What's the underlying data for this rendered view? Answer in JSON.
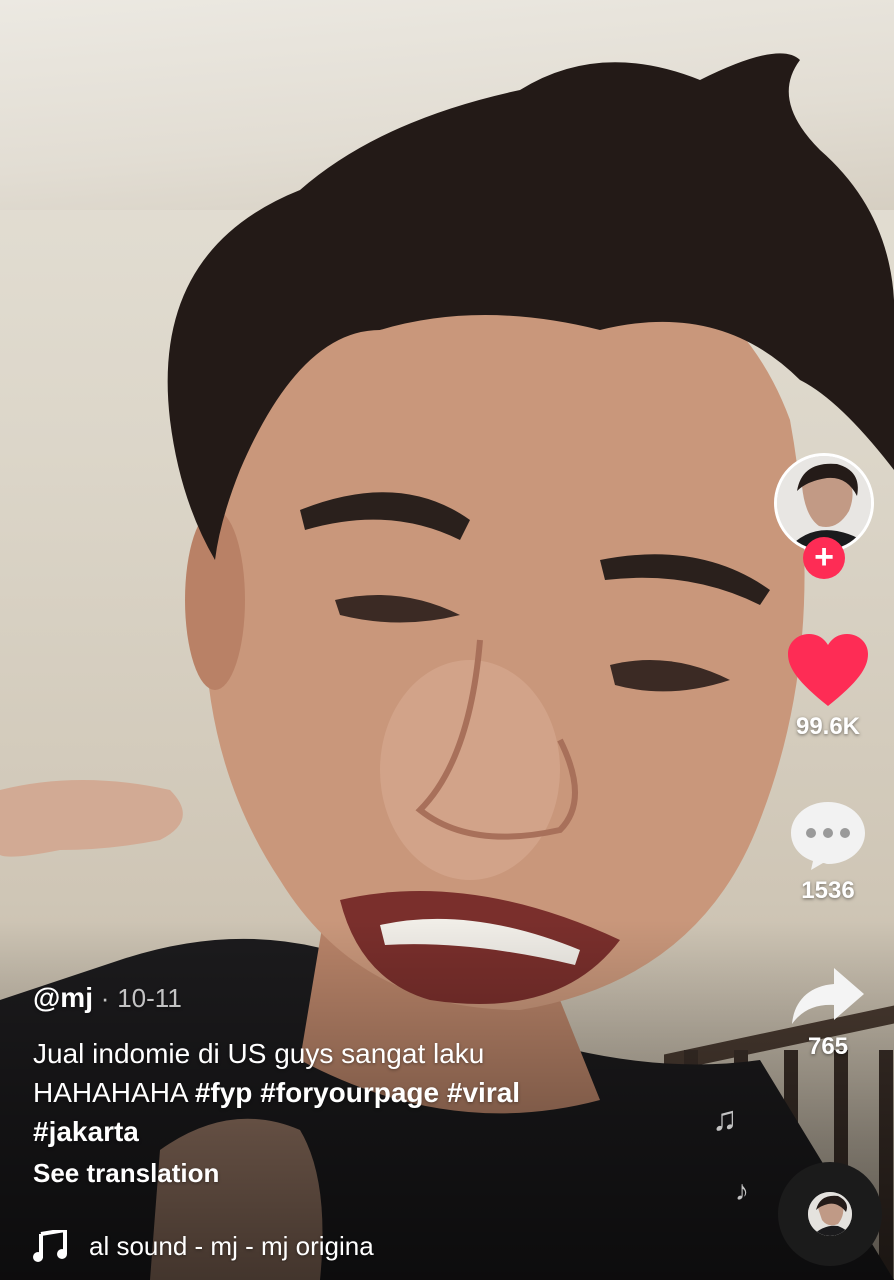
{
  "sidebar": {
    "likes": "99.6K",
    "comments": "1536",
    "shares": "765",
    "follow_symbol": "+"
  },
  "post": {
    "username": "@mj",
    "separator": "·",
    "date": "10-11",
    "description_text": "Jual indomie di US guys sangat laku HAHAHAHA ",
    "hashtags": [
      "#fyp",
      "#foryourpage",
      "#viral",
      "#jakarta"
    ],
    "see_translation": "See translation"
  },
  "music": {
    "title": "al sound - mj - mj    origina"
  },
  "colors": {
    "like_red": "#fe2c55",
    "follow_red": "#fe2c55"
  },
  "icons": {
    "like": "heart-icon",
    "comment": "comment-bubble-icon",
    "share": "share-arrow-icon",
    "music": "music-note-icon"
  }
}
